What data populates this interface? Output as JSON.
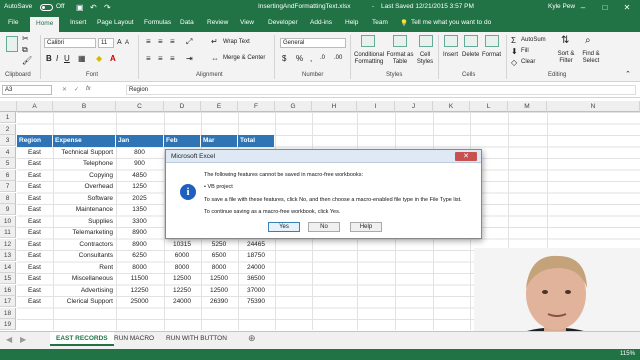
{
  "titlebar": {
    "autosave": "AutoSave",
    "autosave_state": "Off",
    "filename": "InsertingAndFormattingText.xlsx",
    "saved": "Last Saved 12/21/2015 3:57 PM",
    "user": "Kyle Pew"
  },
  "tabs": [
    "File",
    "Home",
    "Insert",
    "Page Layout",
    "Formulas",
    "Data",
    "Review",
    "View",
    "Developer",
    "Add-ins",
    "Help",
    "Team"
  ],
  "tell_me": "Tell me what you want to do",
  "ribbon": {
    "clipboard": "Clipboard",
    "font_group": "Font",
    "alignment": "Alignment",
    "number": "Number",
    "styles": "Styles",
    "cells": "Cells",
    "editing": "Editing",
    "font_name": "Calibri",
    "font_size": "11",
    "wrap_text": "Wrap Text",
    "merge_center": "Merge & Center",
    "number_format": "General",
    "cond_formatting": "Conditional Formatting",
    "format_as_table": "Format as Table",
    "cell_styles": "Cell Styles",
    "insert": "Insert",
    "delete": "Delete",
    "format": "Format",
    "autosum": "AutoSum",
    "fill": "Fill",
    "clear": "Clear",
    "sort_filter": "Sort & Filter",
    "find_select": "Find & Select"
  },
  "formula_bar": {
    "name_box": "A3",
    "fx": "fx",
    "content": "Region"
  },
  "columns": [
    "A",
    "B",
    "C",
    "D",
    "E",
    "F",
    "G",
    "H",
    "I",
    "J",
    "K",
    "L",
    "M",
    "N"
  ],
  "rows": [
    "1",
    "2",
    "3",
    "4",
    "5",
    "6",
    "7",
    "8",
    "9",
    "10",
    "11",
    "12",
    "13",
    "14",
    "15",
    "16",
    "17",
    "18",
    "19"
  ],
  "table": {
    "header": [
      "Region",
      "Expense",
      "Jan",
      "Feb",
      "Mar",
      "Total"
    ],
    "rows": [
      [
        "East",
        "Technical Support",
        "800",
        "",
        "",
        ""
      ],
      [
        "East",
        "Telephone",
        "900",
        "",
        "",
        ""
      ],
      [
        "East",
        "Copying",
        "4850",
        "",
        "",
        ""
      ],
      [
        "East",
        "Overhead",
        "1250",
        "",
        "",
        ""
      ],
      [
        "East",
        "Software",
        "2025",
        "",
        "",
        ""
      ],
      [
        "East",
        "Maintenance",
        "1350",
        "",
        "",
        ""
      ],
      [
        "East",
        "Supplies",
        "3300",
        "",
        "",
        ""
      ],
      [
        "East",
        "Telemarketing",
        "8900",
        "",
        "",
        ""
      ],
      [
        "East",
        "Contractors",
        "8900",
        "10315",
        "5250",
        "24465"
      ],
      [
        "East",
        "Consultants",
        "6250",
        "6000",
        "6500",
        "18750"
      ],
      [
        "East",
        "Rent",
        "8000",
        "8000",
        "8000",
        "24000"
      ],
      [
        "East",
        "Miscellaneous",
        "11500",
        "12500",
        "12500",
        "36500"
      ],
      [
        "East",
        "Advertising",
        "12250",
        "12250",
        "12500",
        "37000"
      ],
      [
        "East",
        "Clerical Support",
        "25000",
        "24000",
        "26390",
        "75390"
      ]
    ]
  },
  "dialog": {
    "title": "Microsoft Excel",
    "line1": "The following features cannot be saved in macro-free workbooks:",
    "bullet": "• VB project",
    "line2": "To save a file with these features, click No, and then choose a macro-enabled file type in the File Type list.",
    "line3": "To continue saving as a macro-free workbook, click Yes.",
    "yes": "Yes",
    "no": "No",
    "help": "Help"
  },
  "sheets": [
    "EAST RECORDS",
    "RUN MACRO",
    "RUN WITH BUTTON"
  ],
  "zoom": "115%",
  "colors": {
    "excel_green": "#217346",
    "header_blue": "#2f75b5"
  }
}
